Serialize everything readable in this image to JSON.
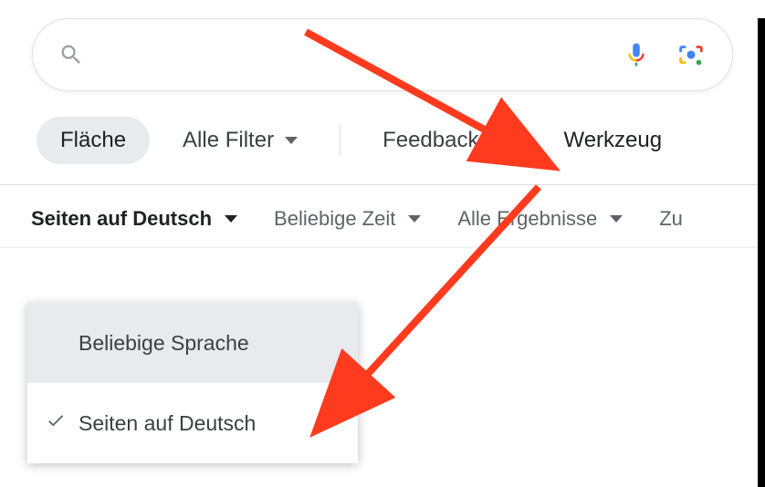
{
  "search": {
    "placeholder": ""
  },
  "chips": {
    "area": "Fläche",
    "all_filters": "Alle Filter",
    "feedback": "Feedback",
    "tools": "Werkzeug"
  },
  "tools": {
    "language": "Seiten auf Deutsch",
    "time": "Beliebige Zeit",
    "results": "Alle Ergebnisse",
    "reset": "Zu"
  },
  "dropdown": {
    "any_language": "Beliebige Sprache",
    "german_pages": "Seiten auf Deutsch"
  }
}
